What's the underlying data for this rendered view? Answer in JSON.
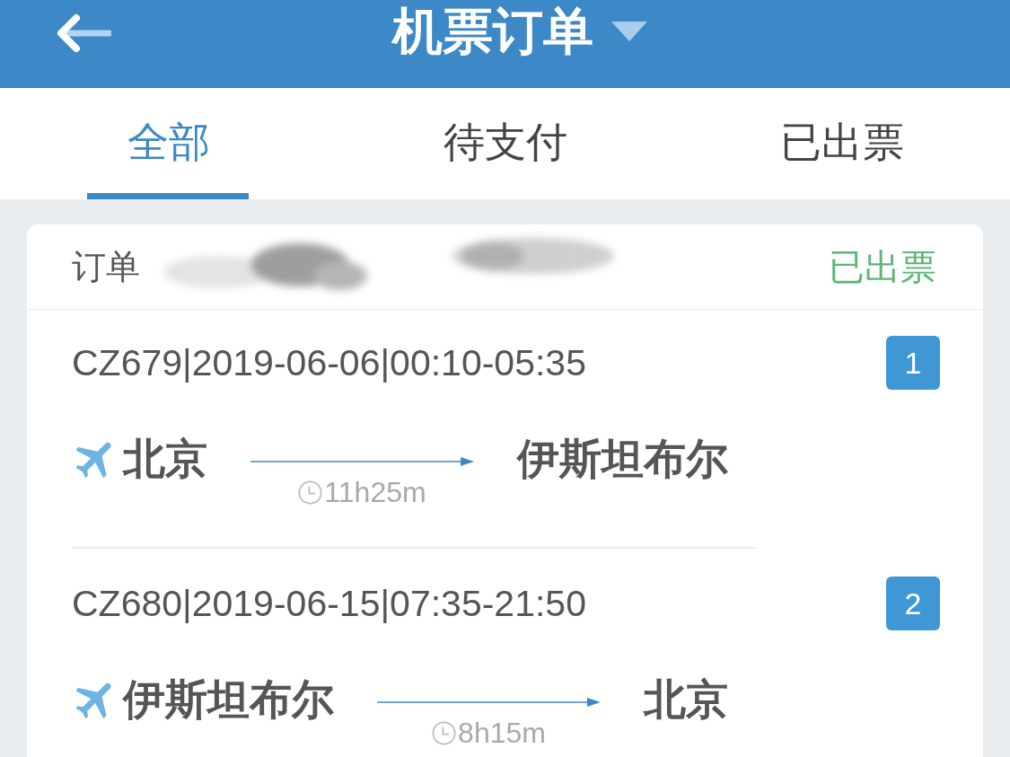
{
  "header": {
    "title": "机票订单"
  },
  "tabs": [
    {
      "label": "全部",
      "selected": true
    },
    {
      "label": "待支付",
      "selected": false
    },
    {
      "label": "已出票",
      "selected": false
    }
  ],
  "order": {
    "label": "订单",
    "status": "已出票",
    "segments": [
      {
        "flight": "CZ679|2019-06-06|00:10-05:35",
        "number": "1",
        "origin": "北京",
        "destination": "伊斯坦布尔",
        "duration": "11h25m"
      },
      {
        "flight": "CZ680|2019-06-15|07:35-21:50",
        "number": "2",
        "origin": "伊斯坦布尔",
        "destination": "北京",
        "duration": "8h15m"
      }
    ]
  }
}
